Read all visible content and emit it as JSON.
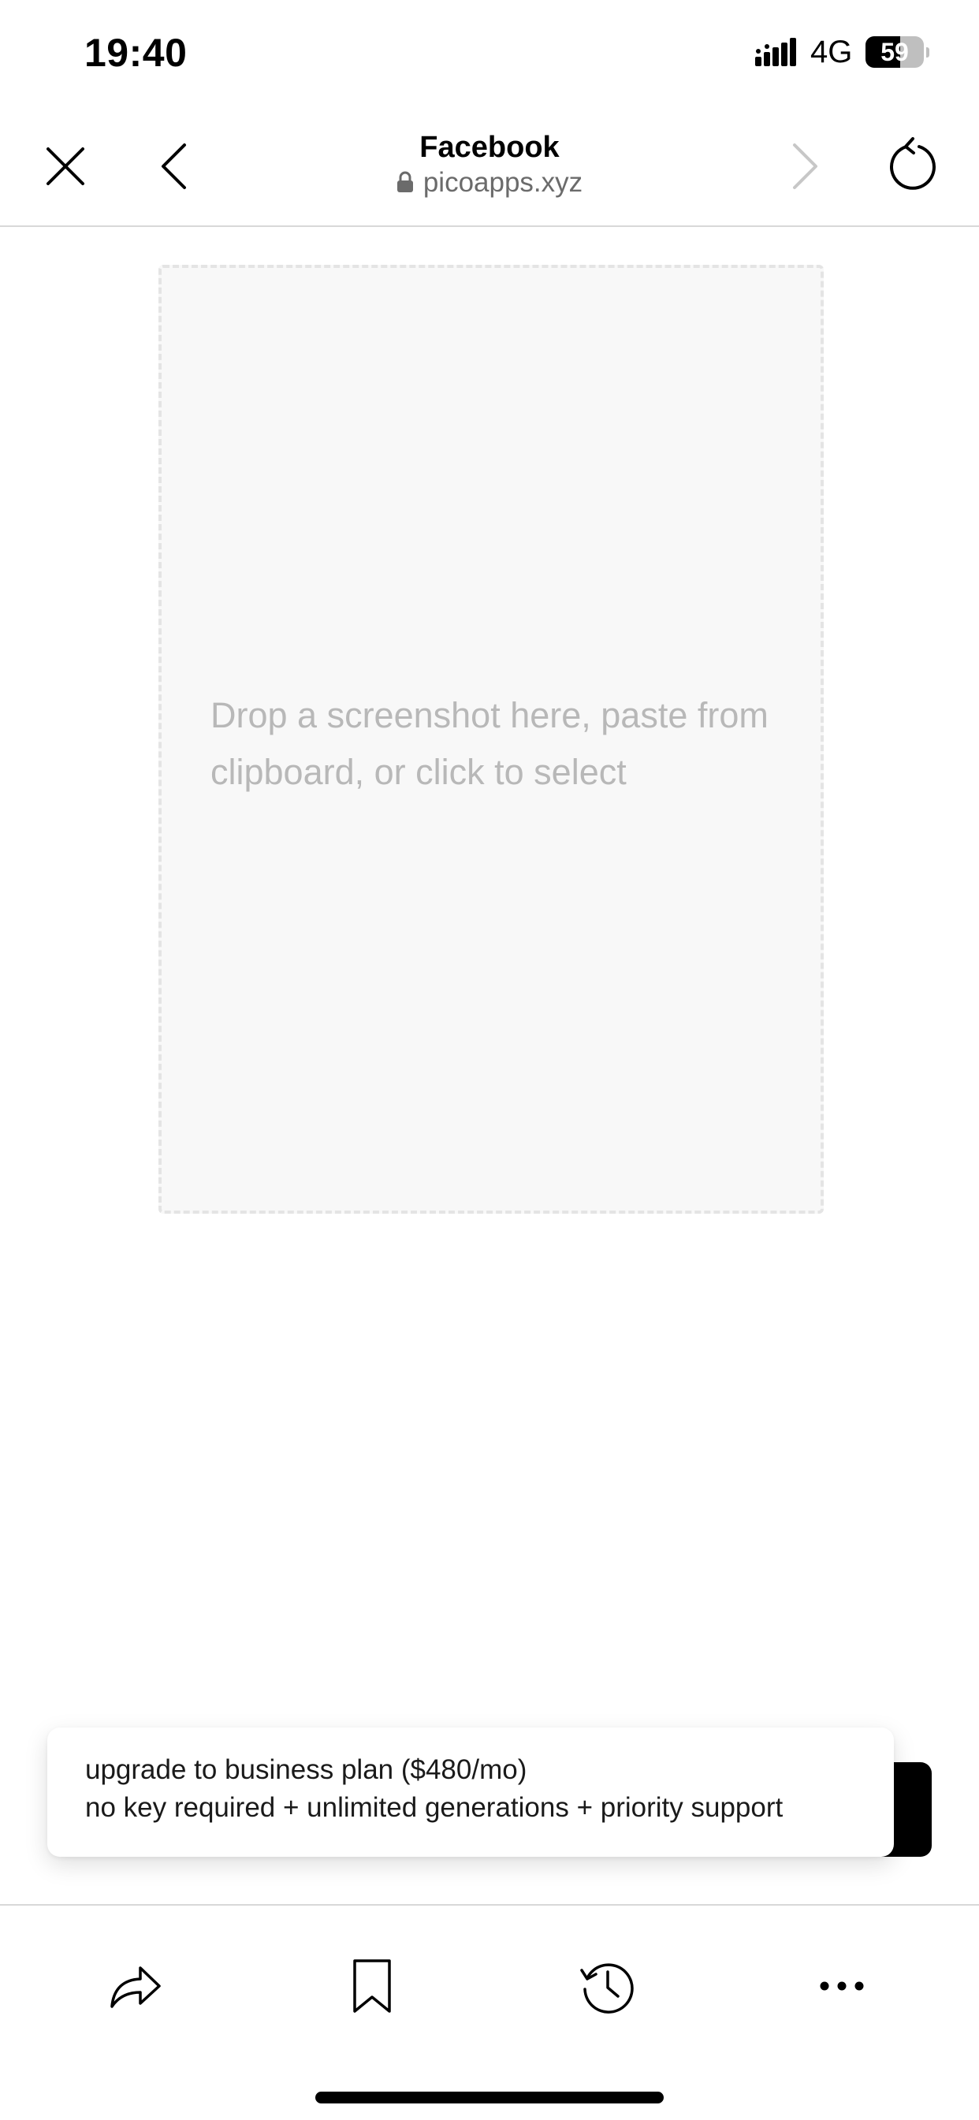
{
  "status_bar": {
    "time": "19:40",
    "network": "4G",
    "battery_level": "59",
    "battery_fraction": 0.59
  },
  "browser": {
    "title": "Facebook",
    "url": "picoapps.xyz",
    "icons": {
      "close": "close-icon",
      "back": "chevron-left-icon",
      "forward": "chevron-right-icon",
      "reload": "reload-icon",
      "lock": "lock-icon"
    },
    "forward_enabled": false
  },
  "main": {
    "drop_zone_text": "Drop a screenshot here, paste from clipboard, or click to select"
  },
  "toast": {
    "line1": "upgrade to business plan ($480/mo)",
    "line2": "no key required + unlimited generations + priority support"
  },
  "toolbar": {
    "icons": [
      "share-icon",
      "bookmark-icon",
      "history-icon",
      "more-icon"
    ]
  },
  "colors": {
    "drop_zone_bg": "#f8f8f8",
    "drop_zone_border": "#e4e4e4",
    "placeholder_text": "#b8b8b8",
    "disabled_icon": "#c7c7c7"
  }
}
